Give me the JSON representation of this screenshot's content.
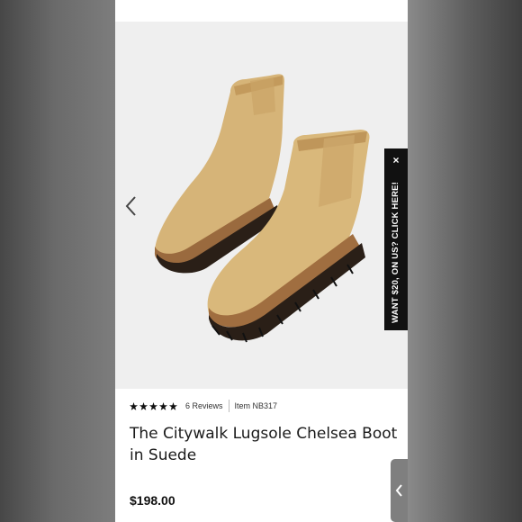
{
  "promo": {
    "text": "WANT $20, ON US? CLICK HERE!",
    "close_symbol": "×"
  },
  "product": {
    "rating": 5,
    "rating_max": 5,
    "reviews": "6 Reviews",
    "item": "Item NB317",
    "title": "The Citywalk Lugsole Chelsea Boot in Suede",
    "price": "$198.00"
  },
  "icons": {
    "gallery_prev": "chevron-left-icon",
    "star": "star-icon",
    "close": "close-icon",
    "side_tab": "chevron-left-icon"
  },
  "colors": {
    "suede": "#d8b77a",
    "sole": "#2a1f17",
    "promo_bg": "#111111",
    "gallery_bg": "#efefef"
  }
}
